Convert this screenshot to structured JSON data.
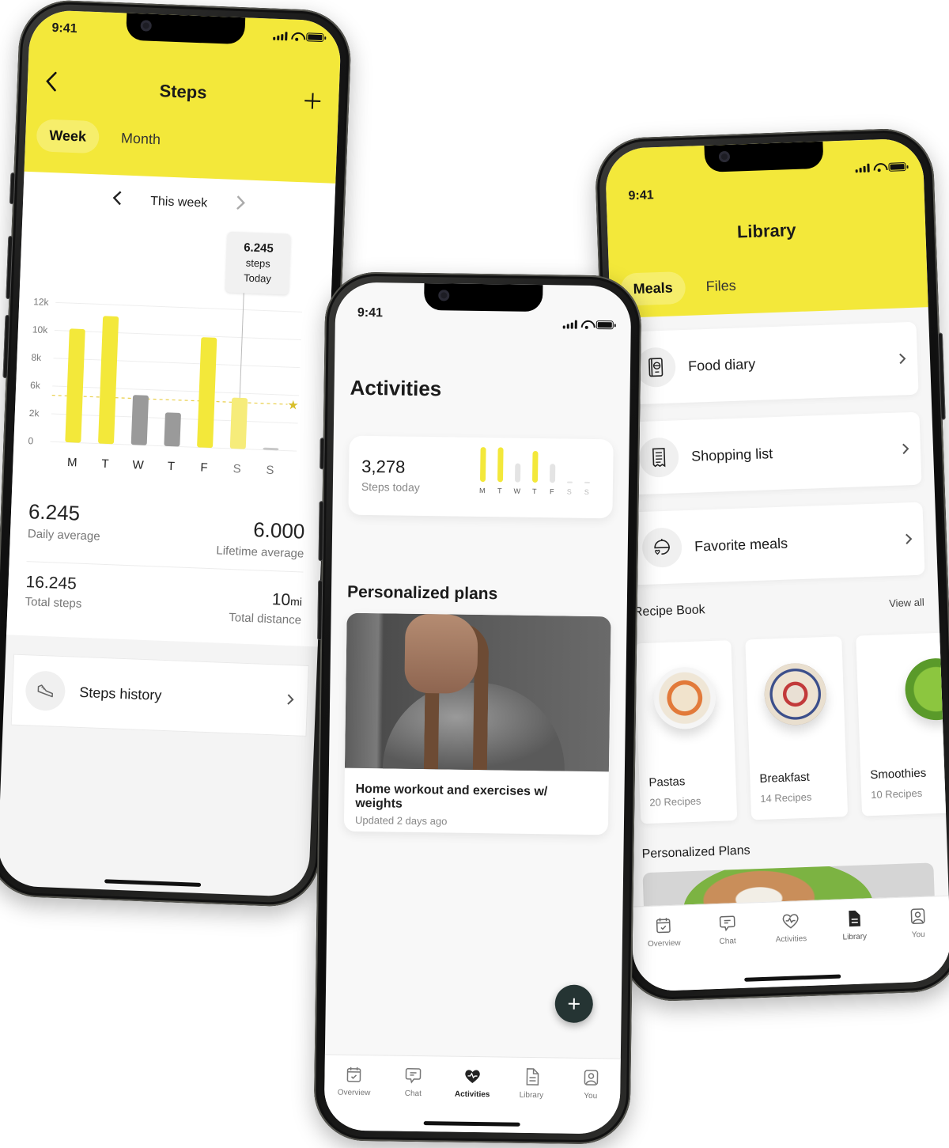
{
  "status_bar": {
    "time": "9:41"
  },
  "steps_screen": {
    "title": "Steps",
    "back_icon": "chevron-left-icon",
    "add_icon": "plus-icon",
    "tabs": [
      {
        "label": "Week",
        "active": true
      },
      {
        "label": "Month",
        "active": false
      }
    ],
    "period_label": "This week",
    "tooltip": {
      "value": "6.245",
      "unit": "steps",
      "caption": "Today"
    },
    "stats": {
      "daily_average": {
        "value": "6.245",
        "label": "Daily average"
      },
      "lifetime_average": {
        "value": "6.000",
        "label": "Lifetime average"
      },
      "total_steps": {
        "value": "16.245",
        "label": "Total steps"
      },
      "total_distance": {
        "value": "10",
        "unit": "mi",
        "label": "Total distance"
      }
    },
    "history_item": {
      "label": "Steps history",
      "icon": "sneaker-icon"
    }
  },
  "chart_data": {
    "type": "bar",
    "title": "",
    "xlabel": "",
    "ylabel": "",
    "categories": [
      "M",
      "T",
      "W",
      "T",
      "F",
      "S",
      "S"
    ],
    "ytick_labels": [
      "0",
      "2k",
      "6k",
      "8k",
      "10k",
      "12k"
    ],
    "ylim": [
      0,
      12000
    ],
    "values": [
      9800,
      11000,
      4300,
      2900,
      9500,
      4400,
      200
    ],
    "goal_met": [
      true,
      true,
      false,
      false,
      true,
      false,
      false
    ],
    "highlighted_index": 5,
    "highlight_label": "6.245 steps Today",
    "goal_line": {
      "value": 4000,
      "style": "dashed",
      "marker": "star"
    },
    "colors": {
      "goal_met": "#f3e83a",
      "below_goal": "#9a9a9a",
      "today": "#f6ec7a",
      "future": "#c8c8c8",
      "goal_line": "#e9cf4a"
    },
    "grid": true,
    "legend": "none"
  },
  "activities_screen": {
    "title": "Activities",
    "steps_card": {
      "value": "3,278",
      "label": "Steps today",
      "days": [
        "M",
        "T",
        "W",
        "T",
        "F",
        "S",
        "S"
      ],
      "levels": [
        1.0,
        1.0,
        0.55,
        0.9,
        0.55,
        0.05,
        0.05
      ],
      "goal_met": [
        true,
        true,
        false,
        true,
        false,
        false,
        false
      ]
    },
    "plans_title": "Personalized plans",
    "plan": {
      "title": "Home workout and exercises w/ weights",
      "meta": "Updated 2 days ago"
    },
    "fab_icon": "plus-icon"
  },
  "library_screen": {
    "title": "Library",
    "tabs": [
      {
        "label": "Meals",
        "active": true
      },
      {
        "label": "Files",
        "active": false
      }
    ],
    "items": [
      {
        "label": "Food diary",
        "icon": "food-diary-icon"
      },
      {
        "label": "Shopping list",
        "icon": "receipt-icon"
      },
      {
        "label": "Favorite meals",
        "icon": "favorite-dish-icon"
      }
    ],
    "recipe_book": {
      "title": "Recipe Book",
      "view_all": "View all",
      "recipes": [
        {
          "name": "Pastas",
          "count": "20 Recipes"
        },
        {
          "name": "Breakfast",
          "count": "14 Recipes"
        },
        {
          "name": "Smoothies",
          "count": "10 Recipes"
        }
      ]
    },
    "plans_title": "Personalized Plans"
  },
  "tabbar": {
    "items": [
      {
        "label": "Overview",
        "icon": "calendar-check-icon"
      },
      {
        "label": "Chat",
        "icon": "chat-icon"
      },
      {
        "label": "Activities",
        "icon": "heart-pulse-icon"
      },
      {
        "label": "Library",
        "icon": "document-icon"
      },
      {
        "label": "You",
        "icon": "user-icon"
      }
    ]
  },
  "colors": {
    "brand_yellow": "#f3e83a",
    "fab": "#253433",
    "text": "#1b1b1b",
    "muted": "#888888"
  }
}
